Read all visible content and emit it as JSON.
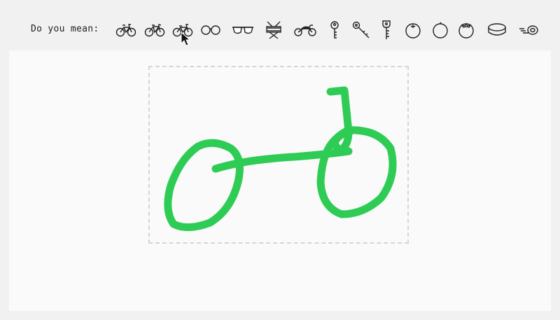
{
  "prompt": {
    "label": "Do you mean:"
  },
  "suggestions": [
    {
      "icon": "bicycle-icon"
    },
    {
      "icon": "bicycle-icon"
    },
    {
      "icon": "bicycle-icon"
    },
    {
      "icon": "eyeglasses-icon"
    },
    {
      "icon": "sunglasses-icon"
    },
    {
      "icon": "drum-icon"
    },
    {
      "icon": "motorcycle-icon"
    },
    {
      "icon": "key-icon"
    },
    {
      "icon": "key-icon"
    },
    {
      "icon": "key-icon"
    },
    {
      "icon": "blueberry-icon"
    },
    {
      "icon": "orange-icon"
    },
    {
      "icon": "tomato-icon"
    },
    {
      "icon": "hockey-puck-icon"
    },
    {
      "icon": "tape-icon"
    }
  ],
  "drawing": {
    "stroke_color": "#2ecc55"
  },
  "colors": {
    "toolbar_bg": "#f1f1f1",
    "canvas_bg": "#fafafa",
    "frame_border": "#d6d6d6"
  }
}
